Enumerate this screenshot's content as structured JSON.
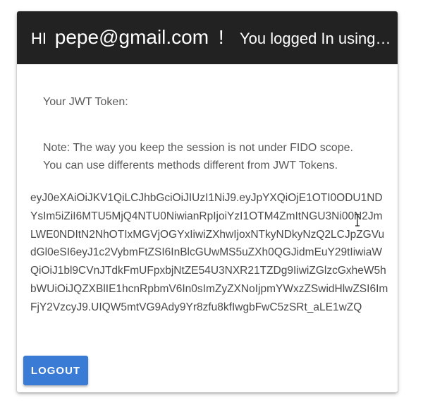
{
  "header": {
    "hi": "HI",
    "email": "pepe@gmail.com",
    "exclamation": "!",
    "login_method": "You logged In using JWT"
  },
  "content": {
    "token_label": "Your JWT Token:",
    "note_line1": "Note: The way you keep the session is not under FIDO scope.",
    "note_line2": "You can use differents methods different from JWT Tokens.",
    "token": "eyJ0eXAiOiJKV1QiLCJhbGciOiJIUzI1NiJ9.eyJpYXQiOjE1OTI0ODU1NDYsIm5iZiI6MTU5MjQ4NTU0NiwianRpIjoiYzI1OTM4ZmItNGU3Ni00N2JmLWE0NDItN2NhOTIxMGVjOGYxIiwiZXhwIjoxNTkyNDkyNzQ2LCJpZGVudGl0eSI6eyJ1c2VybmFtZSI6InBlcGUwMS5uZXh0QGJidmEuY29tIiwiaWQiOiJ1bl9CVnJTdkFmUFpxbjNtZE54U3NXR21TZDg9IiwiZGlzcGxheW5hbWUiOiJQZXBlIE1hcnRpbmV6In0sImZyZXNoIjpmYWxzZSwidHlwZSI6ImFjY2VzcyJ9.UIQW5mtVG9Ady9Yr8zfu8kfIwgbFwC5zSRt_aLE1wZQ"
  },
  "actions": {
    "logout_label": "LOGOUT"
  },
  "colors": {
    "header_bg": "#222222",
    "button_bg": "#3a7bd5",
    "text": "#5a5a5a"
  }
}
